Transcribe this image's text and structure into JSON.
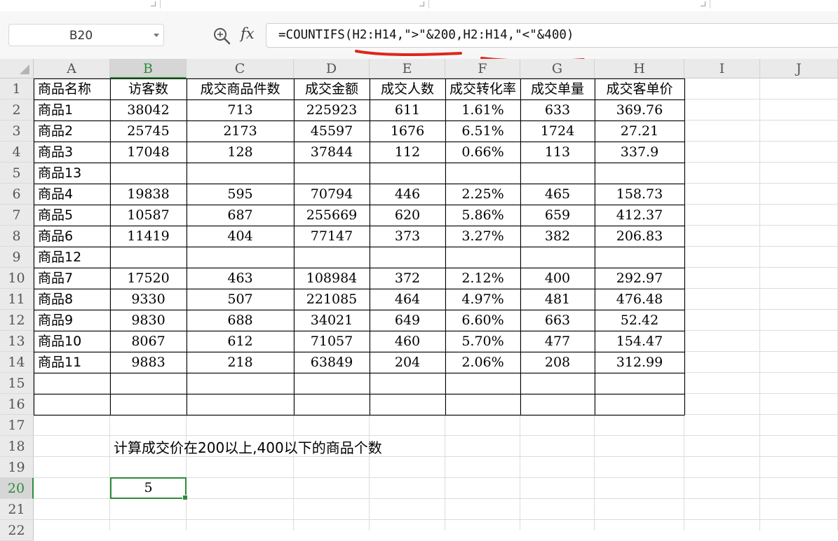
{
  "name_box": {
    "value": "B20"
  },
  "formula_bar": {
    "fx_label": "fx",
    "formula": "=COUNTIFS(H2:H14,\">\"&200,H2:H14,\"<\"&400)"
  },
  "columns": [
    "A",
    "B",
    "C",
    "D",
    "E",
    "F",
    "G",
    "H",
    "I",
    "J"
  ],
  "rows": [
    "1",
    "2",
    "3",
    "4",
    "5",
    "6",
    "7",
    "8",
    "9",
    "10",
    "11",
    "12",
    "13",
    "14",
    "15",
    "16",
    "17",
    "18",
    "19",
    "20",
    "21",
    "22"
  ],
  "active_cell": {
    "column": "B",
    "row": "20"
  },
  "table": {
    "headers": [
      "商品名称",
      "访客数",
      "成交商品件数",
      "成交金额",
      "成交人数",
      "成交转化率",
      "成交单量",
      "成交客单价"
    ],
    "rows": [
      [
        "商品1",
        "38042",
        "713",
        "225923",
        "611",
        "1.61%",
        "633",
        "369.76"
      ],
      [
        "商品2",
        "25745",
        "2173",
        "45597",
        "1676",
        "6.51%",
        "1724",
        "27.21"
      ],
      [
        "商品3",
        "17048",
        "128",
        "37844",
        "112",
        "0.66%",
        "113",
        "337.9"
      ],
      [
        "商品13",
        "",
        "",
        "",
        "",
        "",
        "",
        ""
      ],
      [
        "商品4",
        "19838",
        "595",
        "70794",
        "446",
        "2.25%",
        "465",
        "158.73"
      ],
      [
        "商品5",
        "10587",
        "687",
        "255669",
        "620",
        "5.86%",
        "659",
        "412.37"
      ],
      [
        "商品6",
        "11419",
        "404",
        "77147",
        "373",
        "3.27%",
        "382",
        "206.83"
      ],
      [
        "商品12",
        "",
        "",
        "",
        "",
        "",
        "",
        ""
      ],
      [
        "商品7",
        "17520",
        "463",
        "108984",
        "372",
        "2.12%",
        "400",
        "292.97"
      ],
      [
        "商品8",
        "9330",
        "507",
        "221085",
        "464",
        "4.97%",
        "481",
        "476.48"
      ],
      [
        "商品9",
        "9830",
        "688",
        "34021",
        "649",
        "6.60%",
        "663",
        "52.42"
      ],
      [
        "商品10",
        "8067",
        "612",
        "71057",
        "460",
        "5.70%",
        "477",
        "154.47"
      ],
      [
        "商品11",
        "9883",
        "218",
        "63849",
        "204",
        "2.06%",
        "208",
        "312.99"
      ]
    ]
  },
  "note": "计算成交价在200以上,400以下的商品个数",
  "result": "5",
  "colors": {
    "accent_green": "#2e8b3a",
    "annotation_red": "#e0251b"
  }
}
